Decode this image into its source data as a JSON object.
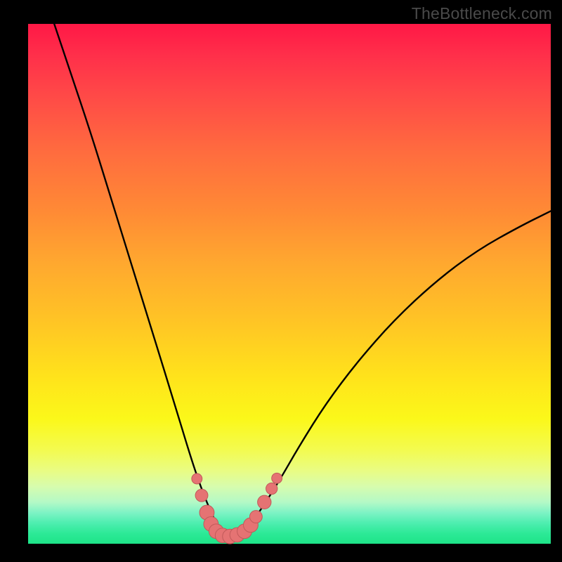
{
  "watermark": "TheBottleneck.com",
  "colors": {
    "background": "#000000",
    "curve": "#000000",
    "marker_fill": "#e57373",
    "marker_stroke": "#c15a5a",
    "gradient_top": "#ff1846",
    "gradient_bottom": "#1de488"
  },
  "chart_data": {
    "type": "line",
    "title": "",
    "xlabel": "",
    "ylabel": "",
    "xlim": [
      0,
      100
    ],
    "ylim": [
      0,
      100
    ],
    "grid": false,
    "legend": false,
    "note": "Bottleneck-style V-curve. x and y are percent of plot width/height (origin bottom-left). Minimum of curve (best match) occurs near x≈38, y≈0.",
    "series": [
      {
        "name": "bottleneck-curve",
        "x": [
          5,
          8,
          12,
          16,
          20,
          24,
          28,
          31,
          33,
          35,
          36.5,
          38,
          40,
          42,
          44.5,
          48,
          52,
          57,
          63,
          70,
          78,
          86,
          94,
          100
        ],
        "y": [
          100,
          91,
          79,
          66,
          53,
          40,
          27,
          17,
          11,
          6,
          3,
          1.5,
          1.5,
          3,
          6.5,
          12,
          19,
          27,
          35,
          43,
          50.5,
          56.5,
          61,
          64
        ]
      }
    ],
    "markers": {
      "name": "highlighted-near-minimum",
      "points": [
        {
          "x": 32.3,
          "y": 12.5,
          "r": 1.0
        },
        {
          "x": 33.2,
          "y": 9.3,
          "r": 1.2
        },
        {
          "x": 34.2,
          "y": 6.0,
          "r": 1.4
        },
        {
          "x": 35.0,
          "y": 3.8,
          "r": 1.4
        },
        {
          "x": 36.0,
          "y": 2.4,
          "r": 1.4
        },
        {
          "x": 37.2,
          "y": 1.6,
          "r": 1.4
        },
        {
          "x": 38.6,
          "y": 1.4,
          "r": 1.4
        },
        {
          "x": 40.0,
          "y": 1.7,
          "r": 1.4
        },
        {
          "x": 41.4,
          "y": 2.4,
          "r": 1.4
        },
        {
          "x": 42.6,
          "y": 3.6,
          "r": 1.4
        },
        {
          "x": 43.6,
          "y": 5.2,
          "r": 1.2
        },
        {
          "x": 45.2,
          "y": 8.0,
          "r": 1.3
        },
        {
          "x": 46.6,
          "y": 10.6,
          "r": 1.1
        },
        {
          "x": 47.6,
          "y": 12.6,
          "r": 1.0
        }
      ]
    }
  }
}
